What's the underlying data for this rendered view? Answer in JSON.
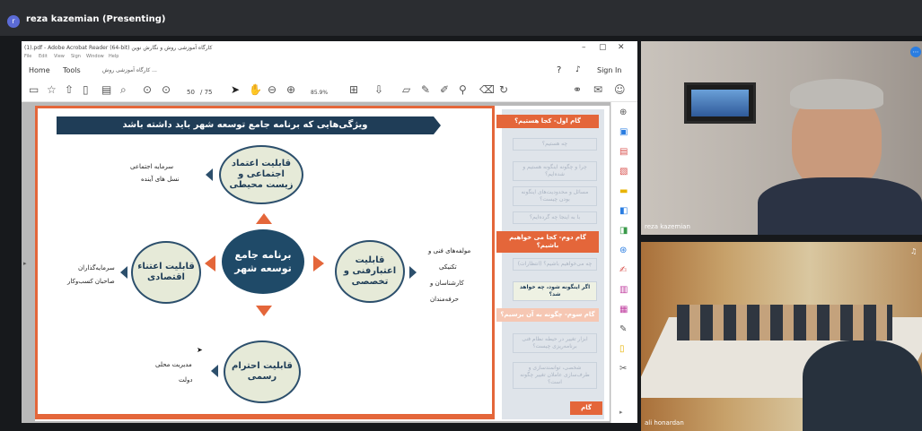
{
  "meeting": {
    "presenter_initial": "r",
    "presenter_label": "reza kazemian (Presenting)"
  },
  "acrobat": {
    "window_title": "(1).pdf - Adobe Acrobat Reader (64-bit) کارگاه آموزشی روش و نگارش نوین",
    "menu": [
      "File",
      "Edit",
      "View",
      "Sign",
      "Window",
      "Help"
    ],
    "tabs": {
      "home": "Home",
      "tools": "Tools",
      "doc": "کارگاه آموزشی روش ..."
    },
    "sign_in": "Sign In",
    "page_current": "50",
    "page_total": "/ 75",
    "zoom": "85.9%"
  },
  "slide": {
    "title": "ویژگی‌هایی که برنامه جامع توسعه شهر باید داشته باشد",
    "center": "برنامه جامع توسعه شهر",
    "top_node": "قابلیت اعتماد اجتماعی و زیست محیطی",
    "left_node": "قابلیت اعتناء اقتصادی",
    "right_node": "قابلیت اعتبارفنی و تخصصی",
    "bottom_node": "قابلیت احترام رسمی",
    "top_bullets": [
      "سرمایه اجتماعی",
      "نسل های آینده"
    ],
    "left_bullets": [
      "سرمایه‌گذاران",
      "صاحبان کسب‌وکار"
    ],
    "right_bullets": [
      "مولفه‌های فنی و",
      "تکنیکی",
      "کارشناسان و",
      "حرفه‌مندان"
    ],
    "bottom_bullets": [
      "مدیریت محلی",
      "دولت"
    ],
    "sidebar": {
      "step1": "گام اول- کجا هستیم؟",
      "step1_items": [
        "چه هستیم؟",
        "چرا و چگونه اینگونه هستیم و شده‌ایم؟",
        "مسائل و محدودیت‌های اینگونه بودن چیست؟",
        "با به اینجا چه گرده‌ایم؟"
      ],
      "step2": "گام دوم- کجا می خواهیم باشیم؟",
      "step2_items": [
        "چه می‌خواهیم باشیم؟ (انتظارات)",
        "اگر اینگونه شود، چه خواهد شد؟"
      ],
      "step3": "گام سوم- چگونه به آن برسیم؟",
      "step3_items": [
        "ابزار تغییر در حیطه نظام فنی برنامه‌ریزی چیست؟",
        "شخصی، توانمندسازی و طرف‌سازی عاملان تغییر چگونه است؟"
      ],
      "step4": "گام"
    }
  },
  "video": {
    "cam1_name": "reza kazemian",
    "cam2_name": "ali honardan"
  },
  "colors": {
    "accent": "#e4663a",
    "navy": "#1f3d57",
    "node_fill": "#e6ead8"
  }
}
